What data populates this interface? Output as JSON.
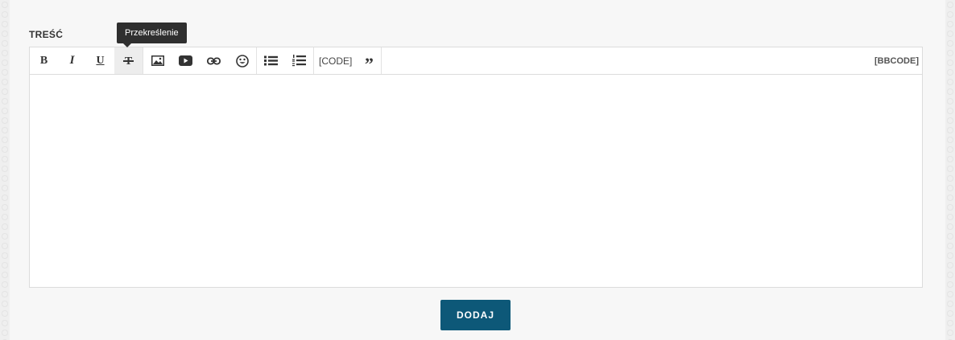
{
  "form": {
    "section_label": "TREŚĆ",
    "submit_label": "DODAJ"
  },
  "toolbar": {
    "code_label": "[CODE]",
    "bbcode_label": "[BBCODE]",
    "tooltip": "Przekreślenie",
    "bold": "B",
    "italic": "I",
    "underline": "U",
    "strike": "T",
    "quote": "”"
  },
  "icons": [
    "bold-icon",
    "italic-icon",
    "underline-icon",
    "strikethrough-icon",
    "image-icon",
    "youtube-icon",
    "link-icon",
    "emoji-icon",
    "bullet-list-icon",
    "numbered-list-icon",
    "quote-icon"
  ],
  "colors": {
    "button": "#0d5878",
    "tooltip": "#2f2f2f"
  }
}
